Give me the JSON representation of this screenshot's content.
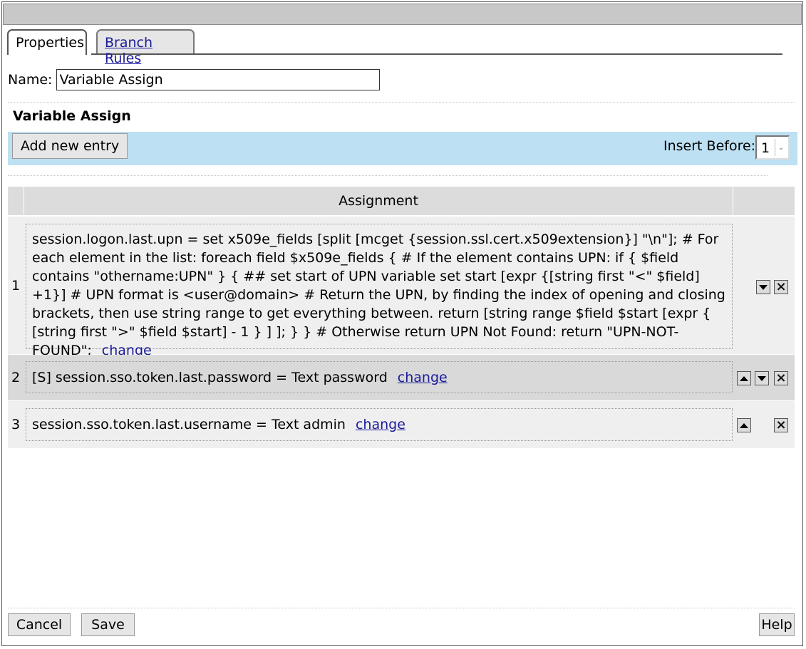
{
  "tabs": {
    "properties": "Properties",
    "branch_rules": "Branch Rules"
  },
  "name_field": {
    "label": "Name:",
    "value": "Variable Assign"
  },
  "section": {
    "title": "Variable Assign"
  },
  "toolbar": {
    "add_label": "Add new entry",
    "insert_before_label": "Insert Before:",
    "insert_before_value": "1"
  },
  "table": {
    "header": "Assignment",
    "rows": [
      {
        "num": "1",
        "text": "session.logon.last.upn = set x509e_fields [split [mcget {session.ssl.cert.x509extension}] \"\\n\"]; # For each element in the list: foreach field $x509e_fields { # If the element contains UPN: if { $field contains \"othername:UPN\" } { ## set start of UPN variable set start [expr {[string first \"<\" $field] +1}] # UPN format is <user@domain> # Return the UPN, by finding the index of opening and closing brackets, then use string range to get everything between. return [string range $field $start [expr { [string first \">\" $field $start] - 1 } ] ]; } } # Otherwise return UPN Not Found: return \"UPN-NOT-FOUND\";",
        "link": "change"
      },
      {
        "num": "2",
        "text": "[S] session.sso.token.last.password = Text password",
        "link": "change"
      },
      {
        "num": "3",
        "text": "session.sso.token.last.username = Text admin",
        "link": "change"
      }
    ]
  },
  "footer": {
    "cancel": "Cancel",
    "save": "Save",
    "help": "Help"
  },
  "colors": {
    "toolbar_bg": "#bde0f3",
    "row_odd_bg": "#efefef",
    "row_even_bg": "#d9d9d9",
    "link": "#1a1a9a"
  }
}
